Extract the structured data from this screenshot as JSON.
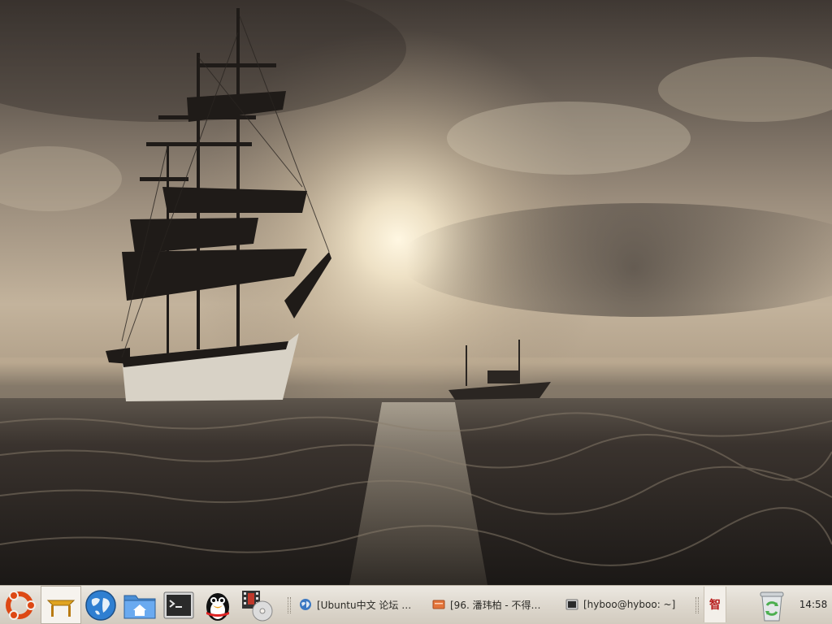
{
  "panel": {
    "launchers": [
      {
        "name": "ubuntu-menu-icon"
      },
      {
        "name": "desktop-table-icon"
      },
      {
        "name": "globe-browser-icon"
      },
      {
        "name": "home-folder-icon"
      },
      {
        "name": "terminal-icon"
      },
      {
        "name": "qq-penguin-icon"
      },
      {
        "name": "media-film-disc-icon"
      }
    ],
    "tasks": [
      {
        "label": "[Ubuntu中文 论坛 …",
        "icon": "firefox-globe-icon"
      },
      {
        "label": "[96. 潘玮柏 - 不得…",
        "icon": "media-player-icon"
      },
      {
        "label": "[hyboo@hyboo: ~]",
        "icon": "terminal-window-icon"
      }
    ],
    "ime_label": "智",
    "trash_icon": "trash-icon",
    "clock": "14:58"
  },
  "colors": {
    "panel_top": "#ece8e1",
    "panel_bottom": "#d2cbbf",
    "ubuntu_orange": "#dd4814",
    "ime_red": "#b71c1c"
  }
}
